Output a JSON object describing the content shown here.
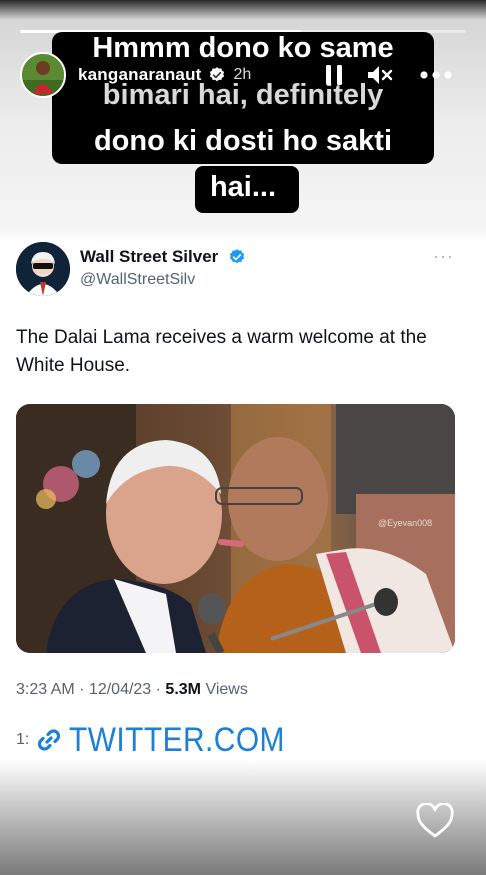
{
  "story": {
    "progress": 0.63,
    "username": "kanganaranaut",
    "time_ago": "2h",
    "caption_line1": "Hmmm dono ko same",
    "caption_line2": "bimari hai, definitely",
    "caption_line3": "dono ki dosti ho sakti",
    "caption_line4": "hai..."
  },
  "tweet": {
    "author_name": "Wall Street Silver",
    "handle": "@WallStreetSilv",
    "more": "···",
    "text": "The Dalai Lama receives a warm welcome at the White House.",
    "image_watermark": "@Eyevan008",
    "time": "3:23 AM",
    "separator": " · ",
    "date": "12/04/23",
    "views_count": "5.3M",
    "views_label": " Views"
  },
  "link_sticker": {
    "prefix": "1:",
    "text": "TWITTER.COM"
  },
  "colors": {
    "twitter_blue": "#1d9bf0",
    "link_blue": "#1d7fd6",
    "caption_bg": "#000000"
  }
}
